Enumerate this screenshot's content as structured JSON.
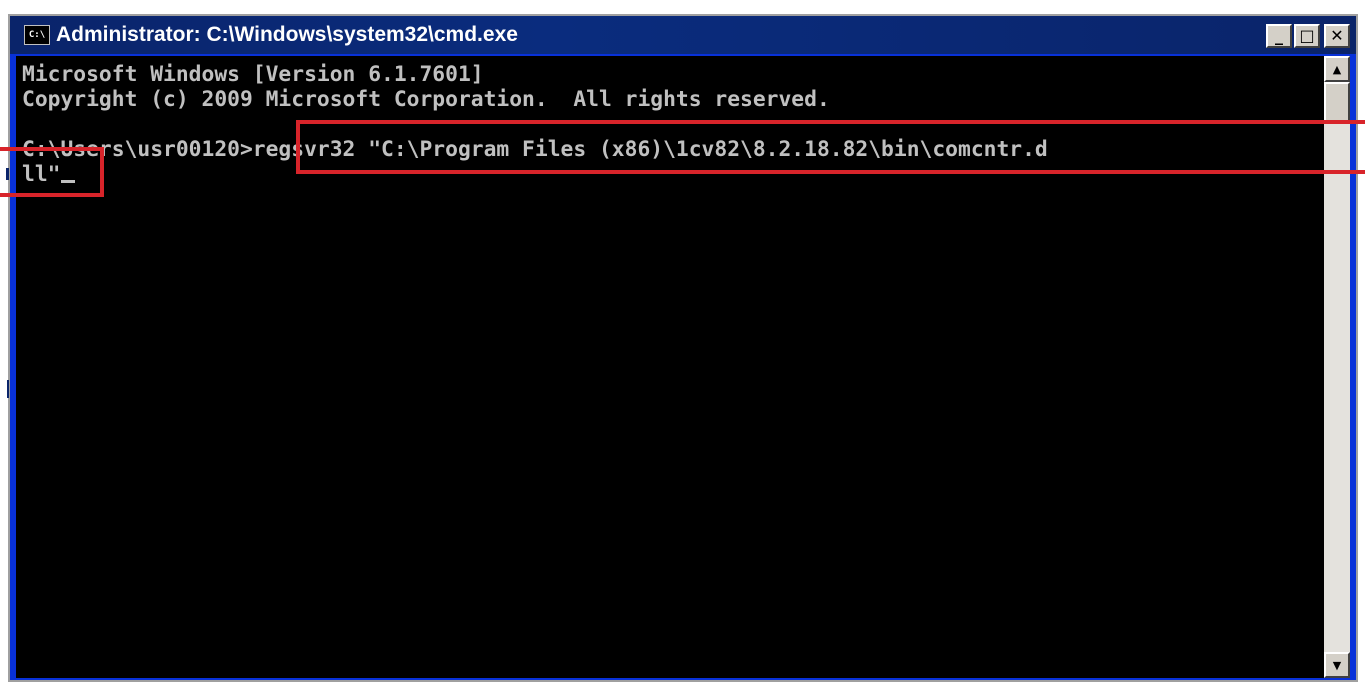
{
  "window": {
    "title": "Administrator: C:\\Windows\\system32\\cmd.exe",
    "icon_label": "C:\\",
    "buttons": {
      "minimize_label": "_",
      "maximize_label": "□",
      "close_label": "✕"
    }
  },
  "console": {
    "lines": [
      "Microsoft Windows [Version 6.1.7601]",
      "Copyright (c) 2009 Microsoft Corporation.  All rights reserved.",
      "",
      "C:\\Users\\usr00120>regsvr32 \"C:\\Program Files (x86)\\1cv82\\8.2.18.82\\bin\\comcntr.d",
      "ll\""
    ],
    "text_color": "#c0c0c0",
    "background_color": "#000000"
  },
  "scrollbar": {
    "up_icon": "▲",
    "down_icon": "▼"
  },
  "annotations": {
    "highlight_color": "#d8242a"
  }
}
